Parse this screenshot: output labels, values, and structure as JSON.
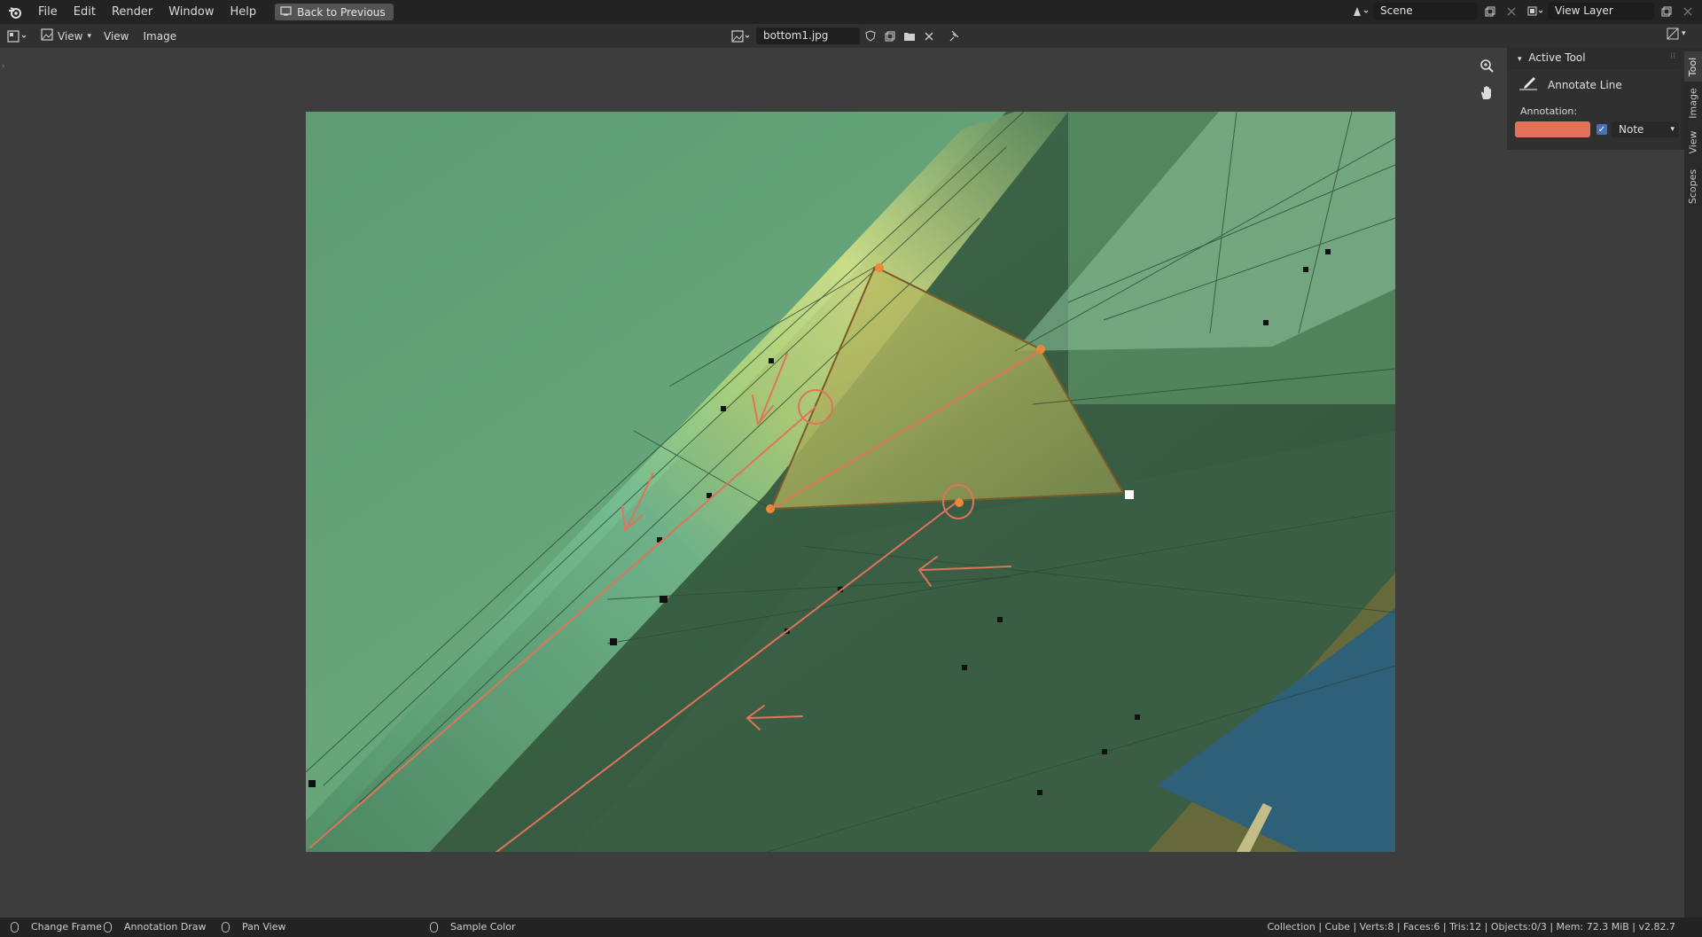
{
  "topbar": {
    "menus": [
      "File",
      "Edit",
      "Render",
      "Window",
      "Help"
    ],
    "back_button": "Back to Previous",
    "scene_name": "Scene",
    "view_layer_name": "View Layer"
  },
  "header": {
    "editor_view_label": "View",
    "menus": [
      "View",
      "Image"
    ],
    "image_name": "bottom1.jpg"
  },
  "npanel": {
    "title": "Active Tool",
    "tool_name": "Annotate Line",
    "annotation_label": "Annotation:",
    "annotation_color": "#e0735a",
    "annotation_layer": "Note",
    "annotation_enabled": true
  },
  "side_tabs": [
    "Tool",
    "Image",
    "View",
    "Scopes"
  ],
  "statusbar": {
    "items": [
      "Change Frame",
      "Annotation Draw",
      "Pan View",
      "Sample Color"
    ],
    "stats": "Collection | Cube | Verts:8 | Faces:6 | Tris:12 | Objects:0/3 | Mem: 72.3 MiB | v2.82.7"
  },
  "colors": {
    "annotation": "#e0735a",
    "accent": "#4772b3",
    "image_green": "#5f9c73"
  }
}
